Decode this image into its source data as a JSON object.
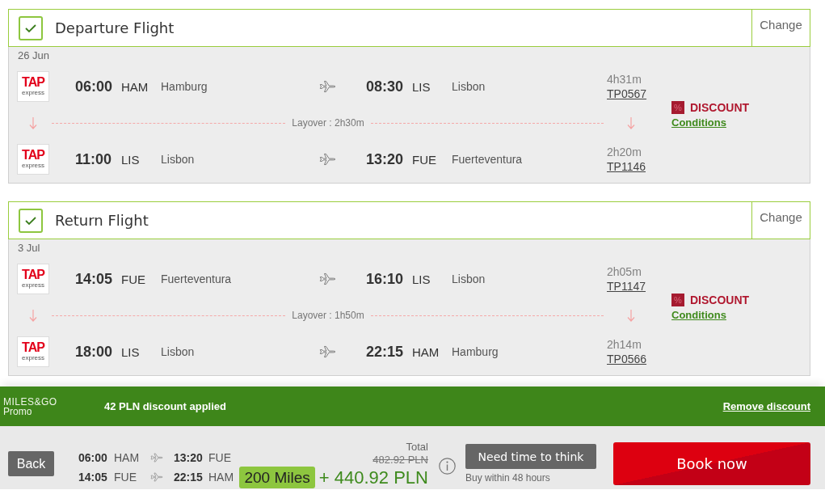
{
  "flights": [
    {
      "title": "Departure Flight",
      "checked": true,
      "change": "Change",
      "date": "26 Jun",
      "segments": [
        {
          "airline": {
            "mark": "TAP",
            "caption": "express"
          },
          "dep_time": "06:00",
          "dep_code": "HAM",
          "dep_city": "Hamburg",
          "arr_time": "08:30",
          "arr_code": "LIS",
          "arr_city": "Lisbon",
          "duration": "4h31m",
          "flight_no": "TP0567"
        },
        {
          "airline": {
            "mark": "TAP",
            "caption": "express"
          },
          "dep_time": "11:00",
          "dep_code": "LIS",
          "dep_city": "Lisbon",
          "arr_time": "13:20",
          "arr_code": "FUE",
          "arr_city": "Fuerteventura",
          "duration": "2h20m",
          "flight_no": "TP1146"
        }
      ],
      "layover": "Layover : 2h30m",
      "discount": {
        "icon": "%",
        "label": "DISCOUNT",
        "link": "Conditions"
      }
    },
    {
      "title": "Return Flight",
      "checked": true,
      "change": "Change",
      "date": "3 Jul",
      "segments": [
        {
          "airline": {
            "mark": "TAP",
            "caption": "express"
          },
          "dep_time": "14:05",
          "dep_code": "FUE",
          "dep_city": "Fuerteventura",
          "arr_time": "16:10",
          "arr_code": "LIS",
          "arr_city": "Lisbon",
          "duration": "2h05m",
          "flight_no": "TP1147"
        },
        {
          "airline": {
            "mark": "TAP",
            "caption": "express"
          },
          "dep_time": "18:00",
          "dep_code": "LIS",
          "dep_city": "Lisbon",
          "arr_time": "22:15",
          "arr_code": "HAM",
          "arr_city": "Hamburg",
          "duration": "2h14m",
          "flight_no": "TP0566"
        }
      ],
      "layover": "Layover : 1h50m",
      "discount": {
        "icon": "%",
        "label": "DISCOUNT",
        "link": "Conditions"
      }
    }
  ],
  "promo": {
    "brand": "MILES&GO",
    "brand_sub": "Promo",
    "message": "42 PLN discount applied",
    "remove": "Remove discount"
  },
  "summary": {
    "back": "Back",
    "journeys": [
      {
        "dep_time": "06:00",
        "dep_code": "HAM",
        "arr_time": "13:20",
        "arr_code": "FUE"
      },
      {
        "dep_time": "14:05",
        "dep_code": "FUE",
        "arr_time": "22:15",
        "arr_code": "HAM"
      }
    ],
    "total_label": "Total",
    "old_price": "482.92 PLN",
    "miles": "200 Miles",
    "plus": "+",
    "amount": "440.92",
    "currency": "PLN",
    "think": "Need time to think",
    "think_note": "Buy within 48 hours",
    "book": "Book now"
  }
}
